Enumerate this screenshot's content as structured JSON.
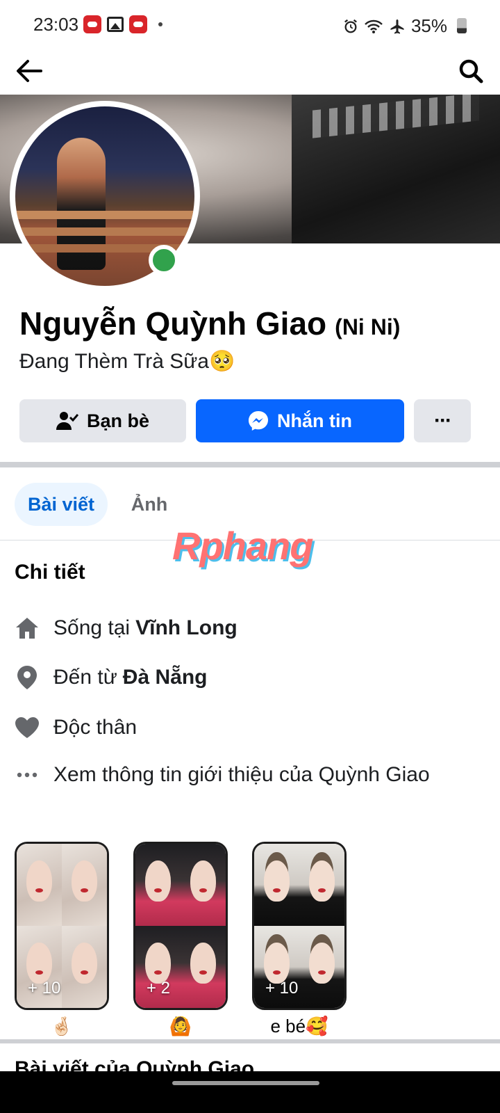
{
  "status_bar": {
    "time": "23:03",
    "notification_icons": [
      "app-notification-icon",
      "gallery-icon",
      "app-notification-icon"
    ],
    "system_icons": [
      "alarm-icon",
      "wifi-icon",
      "airplane-icon",
      "battery-icon"
    ],
    "battery": "35%"
  },
  "top_nav": {
    "back_icon": "back-arrow-icon",
    "search_icon": "search-icon"
  },
  "profile": {
    "name": "Nguyễn Quỳnh Giao",
    "alt_name": "(Ni Ni)",
    "bio": "Đang Thèm Trà Sữa🥺",
    "online": true
  },
  "actions": {
    "friends_label": "Bạn bè",
    "message_label": "Nhắn tin",
    "more_label": "···",
    "message_color": "#0866ff"
  },
  "tabs": [
    {
      "label": "Bài viết",
      "active": true
    },
    {
      "label": "Ảnh",
      "active": false
    }
  ],
  "watermark": "Rphang",
  "details": {
    "title": "Chi tiết",
    "lives_in_prefix": "Sống tại",
    "lives_in_value": "Vĩnh Long",
    "from_prefix": "Đến từ",
    "from_value": "Đà Nẵng",
    "relationship": "Độc thân",
    "see_about": "Xem thông tin giới thiệu của Quỳnh Giao"
  },
  "featured": [
    {
      "count": "+ 10",
      "label": "🤞🏻"
    },
    {
      "count": "+ 2",
      "label": "🙆"
    },
    {
      "count": "+ 10",
      "label": "e bé🥰"
    }
  ],
  "posts_title": "Bài viết của Quỳnh Giao"
}
